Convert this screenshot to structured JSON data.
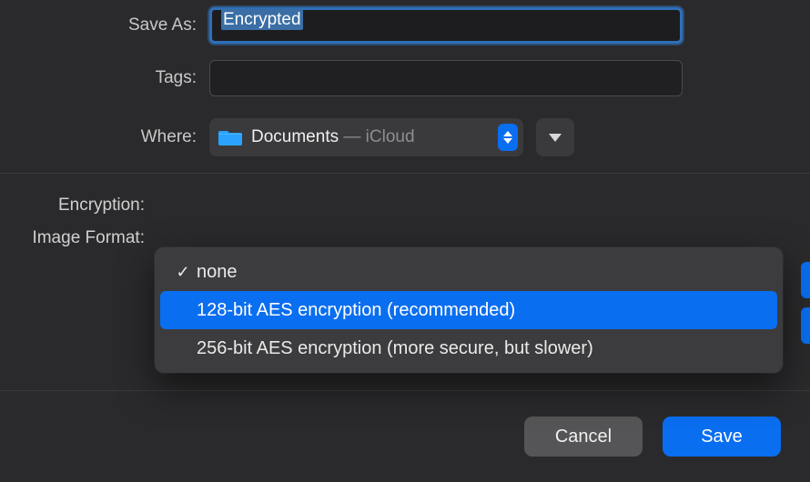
{
  "labels": {
    "save_as": "Save As:",
    "tags": "Tags:",
    "where": "Where:",
    "encryption": "Encryption:",
    "image_format": "Image Format:"
  },
  "fields": {
    "filename": "Encrypted",
    "tags": "",
    "where": {
      "folder": "Documents",
      "separator": " — ",
      "source": "iCloud"
    }
  },
  "encryption_options": {
    "items": [
      {
        "label": "none",
        "selected": true,
        "highlighted": false
      },
      {
        "label": "128-bit AES encryption (recommended)",
        "selected": false,
        "highlighted": true
      },
      {
        "label": "256-bit AES encryption (more secure, but slower)",
        "selected": false,
        "highlighted": false
      }
    ]
  },
  "buttons": {
    "cancel": "Cancel",
    "save": "Save"
  },
  "colors": {
    "accent": "#0a6ef0",
    "bg": "#2a2a2c",
    "popup": "#3c3c3e"
  }
}
